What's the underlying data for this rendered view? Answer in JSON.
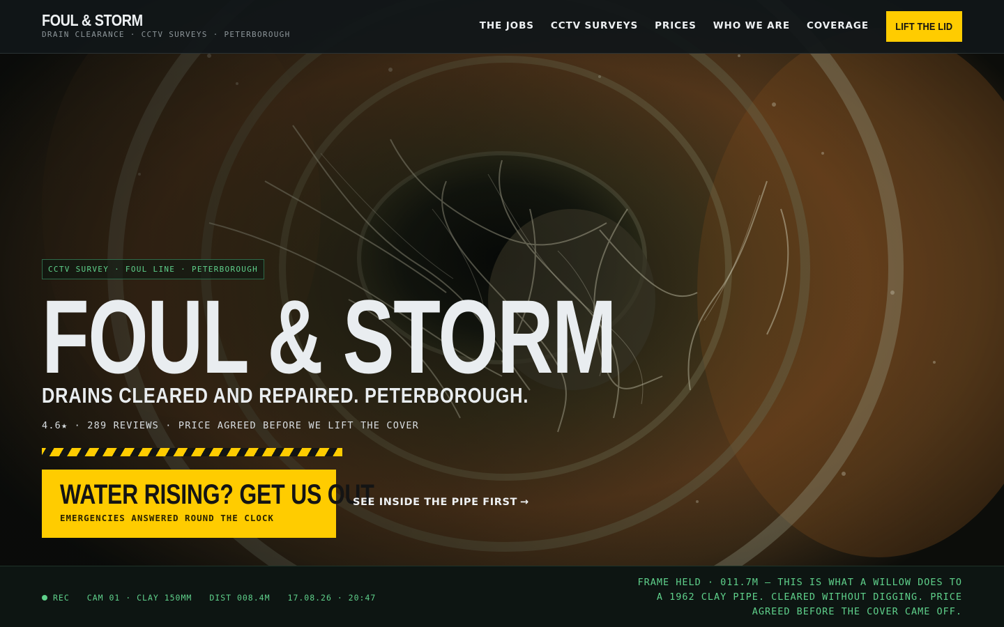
{
  "header": {
    "brand_name": "FOUL & STORM",
    "brand_tagline": "DRAIN CLEARANCE · CCTV SURVEYS · PETERBOROUGH",
    "nav": [
      "THE JOBS",
      "CCTV SURVEYS",
      "PRICES",
      "WHO WE ARE",
      "COVERAGE"
    ],
    "cta_label": "LIFT THE LID"
  },
  "hero": {
    "tag": "CCTV SURVEY · FOUL LINE · PETERBOROUGH",
    "title": "FOUL & STORM",
    "subtitle": "DRAINS CLEARED AND REPAIRED. PETERBOROUGH.",
    "rating": "4.6★",
    "reviews": "289 REVIEWS",
    "promise": "PRICE AGREED BEFORE WE LIFT THE COVER",
    "primary_cta": {
      "label": "WATER RISING? GET US OUT",
      "sublabel": "EMERGENCIES ANSWERED ROUND THE CLOCK"
    },
    "secondary_cta": {
      "label": "SEE INSIDE THE PIPE FIRST",
      "arrow": "→"
    }
  },
  "footer": {
    "rec": "REC",
    "camera": "CAM 01 · CLAY 150MM",
    "distance": "DIST 008.4M",
    "timestamp": "17.08.26 · 20:47",
    "caption": "FRAME HELD · 011.7M — THIS IS WHAT A WILLOW DOES TO A 1962 CLAY PIPE. CLEARED WITHOUT DIGGING. PRICE AGREED BEFORE THE COVER CAME OFF."
  },
  "colors": {
    "accent": "#ffcc00",
    "rec_green": "#5fd18b",
    "header_bg": "#111618",
    "text": "#e9edf0"
  }
}
